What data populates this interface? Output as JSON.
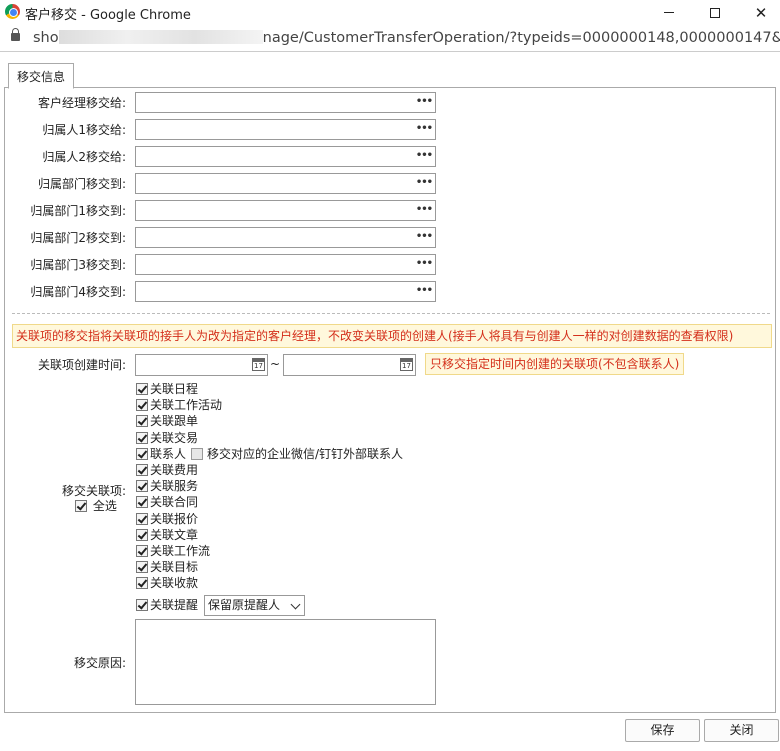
{
  "window": {
    "title": "客户移交 - Google Chrome"
  },
  "address": {
    "url_start": "sho",
    "url_end": "nage/CustomerTransferOperation/?typeids=0000000148,0000000147&..."
  },
  "tab": {
    "label": "移交信息"
  },
  "transfer_fields": [
    {
      "label": "客户经理移交给:",
      "value": ""
    },
    {
      "label": "归属人1移交给:",
      "value": ""
    },
    {
      "label": "归属人2移交给:",
      "value": ""
    },
    {
      "label": "归属部门移交到:",
      "value": ""
    },
    {
      "label": "归属部门1移交到:",
      "value": ""
    },
    {
      "label": "归属部门2移交到:",
      "value": ""
    },
    {
      "label": "归属部门3移交到:",
      "value": ""
    },
    {
      "label": "归属部门4移交到:",
      "value": ""
    }
  ],
  "picker_dots": "•••",
  "notice": "关联项的移交指将关联项的接手人为改为指定的客户经理，不改变关联项的创建人(接手人将具有与创建人一样的对创建数据的查看权限)",
  "create_time": {
    "label": "关联项创建时间:",
    "from": "",
    "to": "",
    "separator": "~",
    "hint": "只移交指定时间内创建的关联项(不包含联系人)"
  },
  "related": {
    "label": "移交关联项:",
    "select_all": {
      "label": "全选",
      "checked": true
    },
    "items": [
      {
        "label": "关联日程",
        "checked": true
      },
      {
        "label": "关联工作活动",
        "checked": true
      },
      {
        "label": "关联跟单",
        "checked": true
      },
      {
        "label": "关联交易",
        "checked": true
      },
      {
        "label": "联系人",
        "checked": true
      },
      {
        "label": "关联费用",
        "checked": true
      },
      {
        "label": "关联服务",
        "checked": true
      },
      {
        "label": "关联合同",
        "checked": true
      },
      {
        "label": "关联报价",
        "checked": true
      },
      {
        "label": "关联文章",
        "checked": true
      },
      {
        "label": "关联工作流",
        "checked": true
      },
      {
        "label": "关联目标",
        "checked": true
      },
      {
        "label": "关联收款",
        "checked": true
      },
      {
        "label": "关联提醒",
        "checked": true
      }
    ],
    "contacts_extra": {
      "label": "移交对应的企业微信/钉钉外部联系人",
      "checked": false
    },
    "reminder_select": {
      "value": "保留原提醒人"
    }
  },
  "reason": {
    "label": "移交原因:",
    "value": ""
  },
  "buttons": {
    "save": "保存",
    "close": "关闭"
  }
}
